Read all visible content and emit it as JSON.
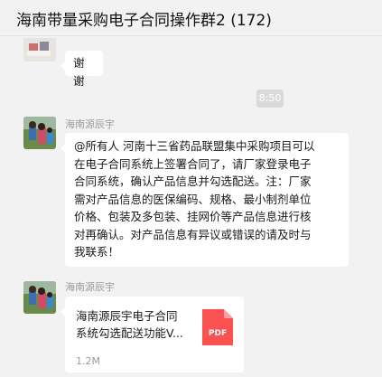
{
  "header": {
    "title": "海南带量采购电子合同操作群2 (172)"
  },
  "messages": [
    {
      "text": "谢谢"
    },
    {
      "time": "8:50"
    },
    {
      "sender": "海南源辰宇",
      "lines": [
        "@所有人 河南十三省药品联盟集中采购项目可以",
        "在电子合同系统上签署合同了，请厂家登录电子",
        "合同系统，确认产品信息并勾选配送。注：厂家",
        "需对产品信息的医保编码、规格、最小制剂单位",
        "价格、包装及多包装、挂网价等产品信息进行核",
        "对再确认。对产品信息有异议或错误的请及时与",
        "我联系！"
      ]
    },
    {
      "sender": "海南源辰宇",
      "file": {
        "name_line1": "海南源辰宇电子合同",
        "name_line2": "系统勾选配送功能V...",
        "size": "1.2M",
        "icon_label": "PDF",
        "icon_color": "#fa5151"
      }
    }
  ]
}
